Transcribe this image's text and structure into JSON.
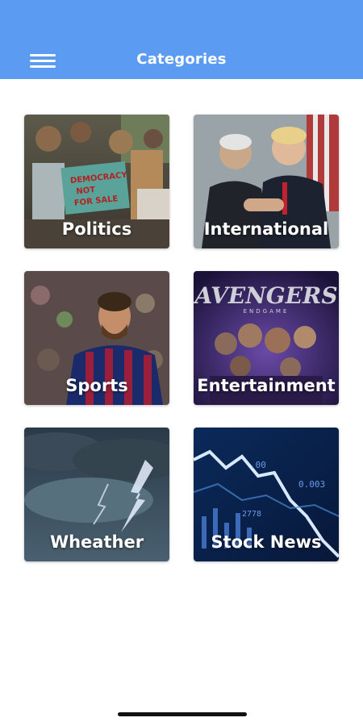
{
  "header": {
    "title": "Categories",
    "menu_icon": "hamburger-menu-icon",
    "background_color": "#5b9cf2"
  },
  "categories": [
    {
      "label": "Politics",
      "image": "protest-crowd-photo"
    },
    {
      "label": "International",
      "image": "leaders-handshake-photo"
    },
    {
      "label": "Sports",
      "image": "football-player-photo"
    },
    {
      "label": "Entertainment",
      "image": "movie-poster-photo"
    },
    {
      "label": "Wheather",
      "image": "storm-lightning-photo"
    },
    {
      "label": "Stock News",
      "image": "stock-chart-photo"
    }
  ]
}
